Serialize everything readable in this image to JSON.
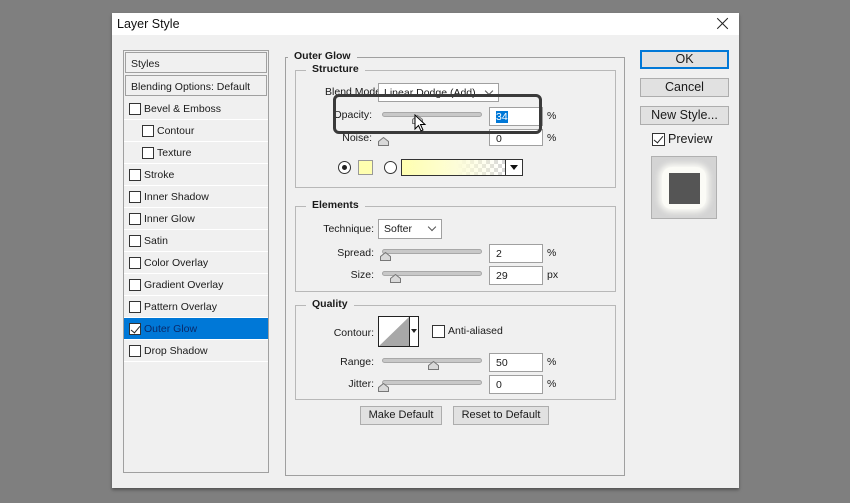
{
  "window": {
    "title": "Layer Style",
    "close_icon": "close-icon"
  },
  "left_panel": {
    "header": "Styles",
    "blending": "Blending Options: Default",
    "items": [
      {
        "label": "Bevel & Emboss",
        "checked": false,
        "indent": false
      },
      {
        "label": "Contour",
        "checked": false,
        "indent": true
      },
      {
        "label": "Texture",
        "checked": false,
        "indent": true
      },
      {
        "label": "Stroke",
        "checked": false,
        "indent": false
      },
      {
        "label": "Inner Shadow",
        "checked": false,
        "indent": false
      },
      {
        "label": "Inner Glow",
        "checked": false,
        "indent": false
      },
      {
        "label": "Satin",
        "checked": false,
        "indent": false
      },
      {
        "label": "Color Overlay",
        "checked": false,
        "indent": false
      },
      {
        "label": "Gradient Overlay",
        "checked": false,
        "indent": false
      },
      {
        "label": "Pattern Overlay",
        "checked": false,
        "indent": false
      },
      {
        "label": "Outer Glow",
        "checked": true,
        "indent": false,
        "selected": true
      },
      {
        "label": "Drop Shadow",
        "checked": false,
        "indent": false
      }
    ]
  },
  "outer_glow": {
    "title": "Outer Glow",
    "structure": {
      "title": "Structure",
      "blend_mode_label": "Blend Mode:",
      "blend_mode_value": "Linear Dodge (Add)",
      "opacity_label": "Opacity:",
      "opacity_value": "34",
      "opacity_unit": "%",
      "opacity_fraction": 0.34,
      "noise_label": "Noise:",
      "noise_value": "0",
      "noise_unit": "%",
      "noise_fraction": 0,
      "color_swatch": "#ffffb0",
      "solid_color_selected": true
    },
    "elements": {
      "title": "Elements",
      "technique_label": "Technique:",
      "technique_value": "Softer",
      "spread_label": "Spread:",
      "spread_value": "2",
      "spread_unit": "%",
      "spread_fraction": 0.02,
      "size_label": "Size:",
      "size_value": "29",
      "size_unit": "px",
      "size_fraction": 0.116
    },
    "quality": {
      "title": "Quality",
      "contour_label": "Contour:",
      "anti_aliased_label": "Anti-aliased",
      "anti_aliased": false,
      "range_label": "Range:",
      "range_value": "50",
      "range_unit": "%",
      "range_fraction": 0.5,
      "jitter_label": "Jitter:",
      "jitter_value": "0",
      "jitter_unit": "%",
      "jitter_fraction": 0
    },
    "make_default": "Make Default",
    "reset_default": "Reset to Default"
  },
  "buttons": {
    "ok": "OK",
    "cancel": "Cancel",
    "new_style": "New Style...",
    "preview_label": "Preview",
    "preview_checked": true
  },
  "colors": {
    "selection": "#0078d7",
    "glow": "#ffffb0",
    "preview_square": "#555555"
  }
}
